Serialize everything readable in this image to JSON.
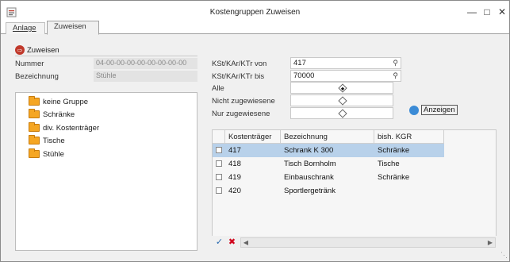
{
  "window": {
    "title": "Kostengruppen Zuweisen",
    "min_icon": "minimize-icon",
    "max_icon": "maximize-icon",
    "close_icon": "close-icon"
  },
  "tabs": [
    {
      "label": "Anlage",
      "active": false
    },
    {
      "label": "Zuweisen",
      "active": true
    }
  ],
  "section": {
    "label": "Zuweisen",
    "icon": "assign-icon"
  },
  "info": {
    "nummer_label": "Nummer",
    "nummer_value": "04-00-00-00-00-00-00-00-00",
    "bezeichnung_label": "Bezeichnung",
    "bezeichnung_value": "Stühle"
  },
  "filter": {
    "von_label": "KSt/KAr/KTr von",
    "von_value": "417",
    "bis_label": "KSt/KAr/KTr bis",
    "bis_value": "70000",
    "options": [
      {
        "label": "Alle",
        "selected": true
      },
      {
        "label": "Nicht zugewiesene",
        "selected": false
      },
      {
        "label": "Nur zugewiesene",
        "selected": false
      }
    ],
    "show_button": "Anzeigen"
  },
  "tree": {
    "items": [
      {
        "label": "keine Gruppe"
      },
      {
        "label": "Schränke"
      },
      {
        "label": "div. Kostenträger"
      },
      {
        "label": "Tische"
      },
      {
        "label": "Stühle"
      }
    ]
  },
  "grid": {
    "columns": [
      "Kostenträger",
      "Bezeichnung",
      "bish. KGR"
    ],
    "rows": [
      {
        "kostentraeger": "417",
        "bezeichnung": "Schrank K 300",
        "kgr": "Schränke",
        "selected": true
      },
      {
        "kostentraeger": "418",
        "bezeichnung": "Tisch Bornholm",
        "kgr": "Tische",
        "selected": false
      },
      {
        "kostentraeger": "419",
        "bezeichnung": "Einbauschrank",
        "kgr": "Schränke",
        "selected": false
      },
      {
        "kostentraeger": "420",
        "bezeichnung": "Sportlergetränk",
        "kgr": "",
        "selected": false
      }
    ]
  },
  "colors": {
    "selection": "#b8d1ea",
    "accent_icon": "#c0392b",
    "folder": "#f5a623"
  }
}
